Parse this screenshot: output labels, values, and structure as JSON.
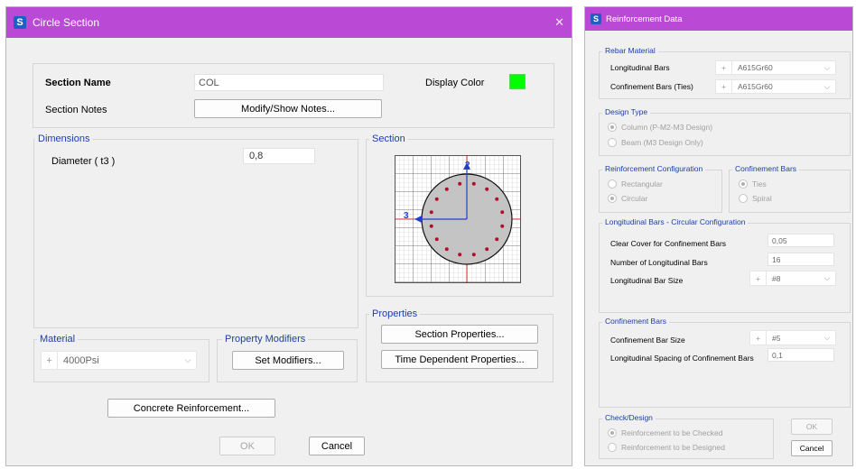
{
  "circle_dialog": {
    "title": "Circle Section",
    "app_icon": "S",
    "close_glyph": "✕",
    "section_name_label": "Section Name",
    "section_name_value": "COL",
    "display_color_label": "Display Color",
    "display_color": "#00ff00",
    "section_notes_label": "Section Notes",
    "modify_notes_button": "Modify/Show Notes...",
    "dimensions_group": "Dimensions",
    "diameter_label": "Diameter  ( t3 )",
    "diameter_value": "0,8",
    "section_group": "Section",
    "axis_2": "2",
    "axis_3": "3",
    "properties_group": "Properties",
    "section_properties_button": "Section Properties...",
    "time_dependent_button": "Time Dependent Properties...",
    "material_group": "Material",
    "material_value": "4000Psi",
    "property_modifiers_group": "Property Modifiers",
    "set_modifiers_button": "Set Modifiers...",
    "concrete_reinforcement_button": "Concrete Reinforcement...",
    "ok_button": "OK",
    "cancel_button": "Cancel"
  },
  "reinf_dialog": {
    "title": "Reinforcement Data",
    "app_icon": "S",
    "rebar_material_group": "Rebar Material",
    "longitudinal_bars_label": "Longitudinal Bars",
    "longitudinal_bars_value": "A615Gr60",
    "confinement_bars_ties_label": "Confinement Bars  (Ties)",
    "confinement_bars_ties_value": "A615Gr60",
    "design_type_group": "Design Type",
    "design_option_column": "Column  (P-M2-M3 Design)",
    "design_option_beam": "Beam  (M3 Design Only)",
    "reinf_config_group": "Reinforcement Configuration",
    "config_rectangular": "Rectangular",
    "config_circular": "Circular",
    "confinement_bars_group": "Confinement Bars",
    "conf_ties": "Ties",
    "conf_spiral": "Spiral",
    "long_circ_group": "Longitudinal Bars - Circular Configuration",
    "clear_cover_label": "Clear Cover for Confinement Bars",
    "clear_cover_value": "0,05",
    "num_long_bars_label": "Number of Longitudinal Bars",
    "num_long_bars_value": "16",
    "long_bar_size_label": "Longitudinal Bar Size",
    "long_bar_size_value": "#8",
    "confinement_group": "Confinement Bars",
    "conf_bar_size_label": "Confinement Bar Size",
    "conf_bar_size_value": "#5",
    "long_spacing_label": "Longitudinal Spacing of Confinement Bars",
    "long_spacing_value": "0,1",
    "check_design_group": "Check/Design",
    "check_option": "Reinforcement to be Checked",
    "design_option": "Reinforcement to be Designed",
    "ok_button": "OK",
    "cancel_button": "Cancel"
  },
  "icons": {
    "plus": "+",
    "chevron": "⌵"
  }
}
